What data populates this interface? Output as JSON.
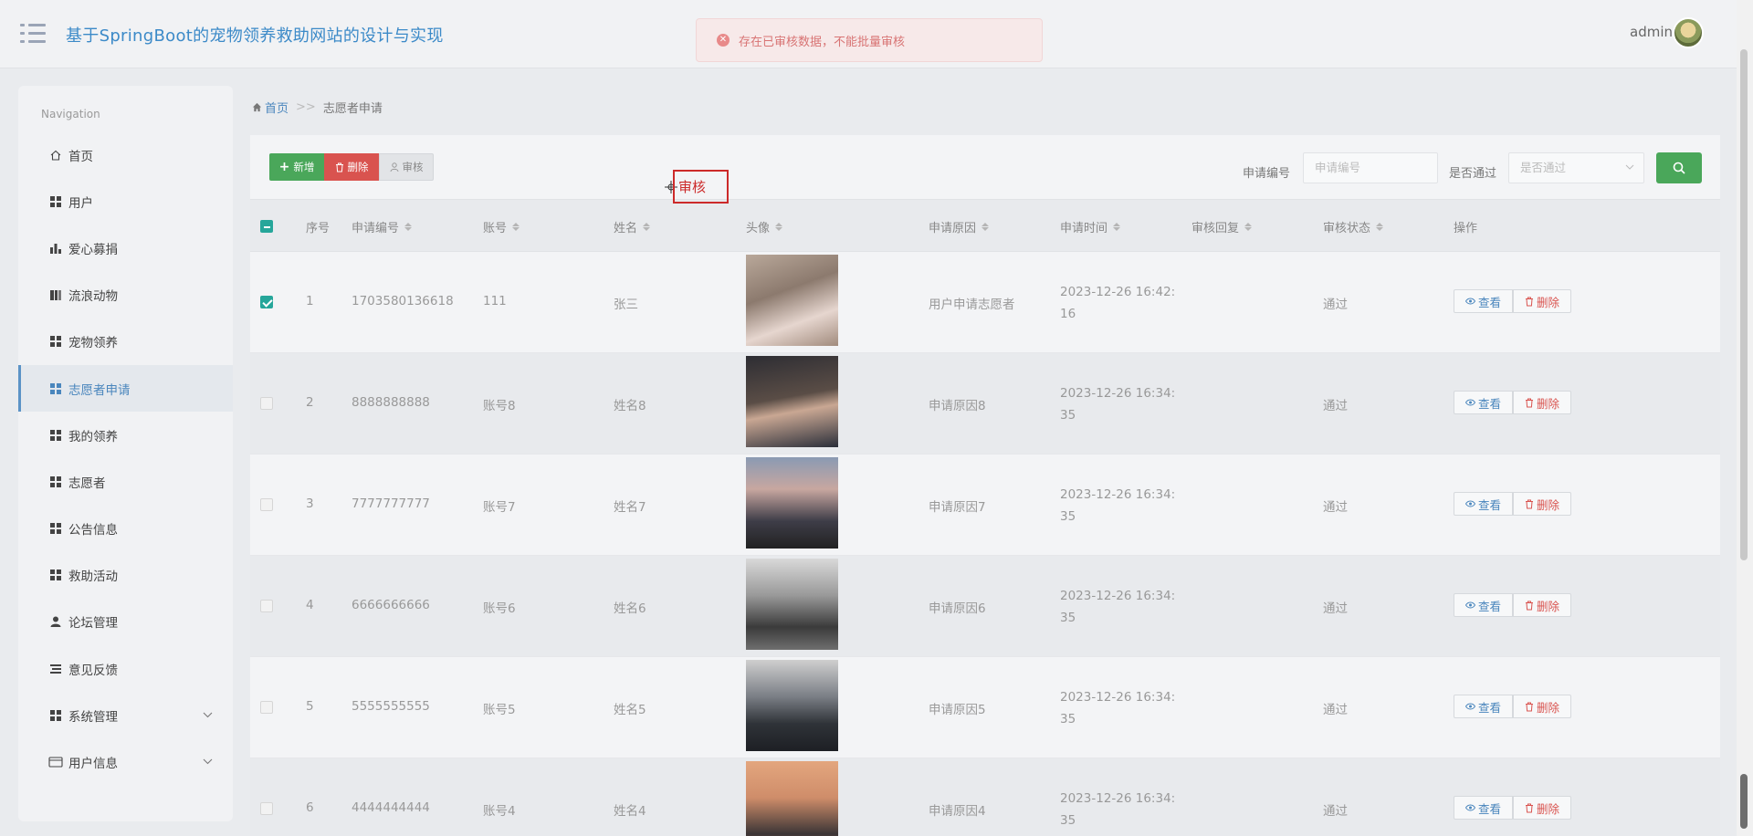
{
  "header": {
    "title": "基于SpringBoot的宠物领养救助网站的设计与实现",
    "username": "admin"
  },
  "alert": {
    "message": "存在已审核数据，不能批量审核"
  },
  "sidebar": {
    "nav_label": "Navigation",
    "items": [
      {
        "label": "首页",
        "icon": "home-icon"
      },
      {
        "label": "用户",
        "icon": "grid-icon"
      },
      {
        "label": "爱心募捐",
        "icon": "bar-chart-icon"
      },
      {
        "label": "流浪动物",
        "icon": "book-icon"
      },
      {
        "label": "宠物领养",
        "icon": "grid-icon"
      },
      {
        "label": "志愿者申请",
        "icon": "grid-icon",
        "active": true
      },
      {
        "label": "我的领养",
        "icon": "grid-icon"
      },
      {
        "label": "志愿者",
        "icon": "grid-icon"
      },
      {
        "label": "公告信息",
        "icon": "grid-icon"
      },
      {
        "label": "救助活动",
        "icon": "grid-icon"
      },
      {
        "label": "论坛管理",
        "icon": "user-icon"
      },
      {
        "label": "意见反馈",
        "icon": "list-icon"
      },
      {
        "label": "系统管理",
        "icon": "grid-icon",
        "expandable": true
      },
      {
        "label": "用户信息",
        "icon": "card-icon",
        "expandable": true
      }
    ]
  },
  "breadcrumb": {
    "home": "首页",
    "separator": ">>",
    "current": "志愿者申请"
  },
  "toolbar": {
    "add_label": "新增",
    "delete_label": "删除",
    "audit_label": "审核",
    "search_label_1": "申请编号",
    "search_placeholder_1": "申请编号",
    "search_label_2": "是否通过",
    "search_placeholder_2": "是否通过"
  },
  "annotation": {
    "label": "审核"
  },
  "table": {
    "headers": [
      "序号",
      "申请编号",
      "账号",
      "姓名",
      "头像",
      "申请原因",
      "申请时间",
      "审核回复",
      "审核状态",
      "操作"
    ],
    "view_label": "查看",
    "delete_label": "删除",
    "rows": [
      {
        "index": "1",
        "app_no": "1703580136618",
        "account": "111",
        "name": "张三",
        "reason": "用户申请志愿者",
        "time_1": "2023-12-26 16:42:",
        "time_2": "16",
        "reply": "",
        "status": "通过",
        "checked": true
      },
      {
        "index": "2",
        "app_no": "8888888888",
        "account": "账号8",
        "name": "姓名8",
        "reason": "申请原因8",
        "time_1": "2023-12-26 16:34:",
        "time_2": "35",
        "reply": "",
        "status": "通过",
        "checked": false
      },
      {
        "index": "3",
        "app_no": "7777777777",
        "account": "账号7",
        "name": "姓名7",
        "reason": "申请原因7",
        "time_1": "2023-12-26 16:34:",
        "time_2": "35",
        "reply": "",
        "status": "通过",
        "checked": false
      },
      {
        "index": "4",
        "app_no": "6666666666",
        "account": "账号6",
        "name": "姓名6",
        "reason": "申请原因6",
        "time_1": "2023-12-26 16:34:",
        "time_2": "35",
        "reply": "",
        "status": "通过",
        "checked": false
      },
      {
        "index": "5",
        "app_no": "5555555555",
        "account": "账号5",
        "name": "姓名5",
        "reason": "申请原因5",
        "time_1": "2023-12-26 16:34:",
        "time_2": "35",
        "reply": "",
        "status": "通过",
        "checked": false
      },
      {
        "index": "6",
        "app_no": "4444444444",
        "account": "账号4",
        "name": "姓名4",
        "reason": "申请原因4",
        "time_1": "2023-12-26 16:34:",
        "time_2": "35",
        "reply": "",
        "status": "通过",
        "checked": false
      }
    ]
  },
  "colors": {
    "accent": "#4a86bd",
    "success": "#4aa75a",
    "danger": "#d9534f",
    "checkbox": "#26a69a"
  }
}
